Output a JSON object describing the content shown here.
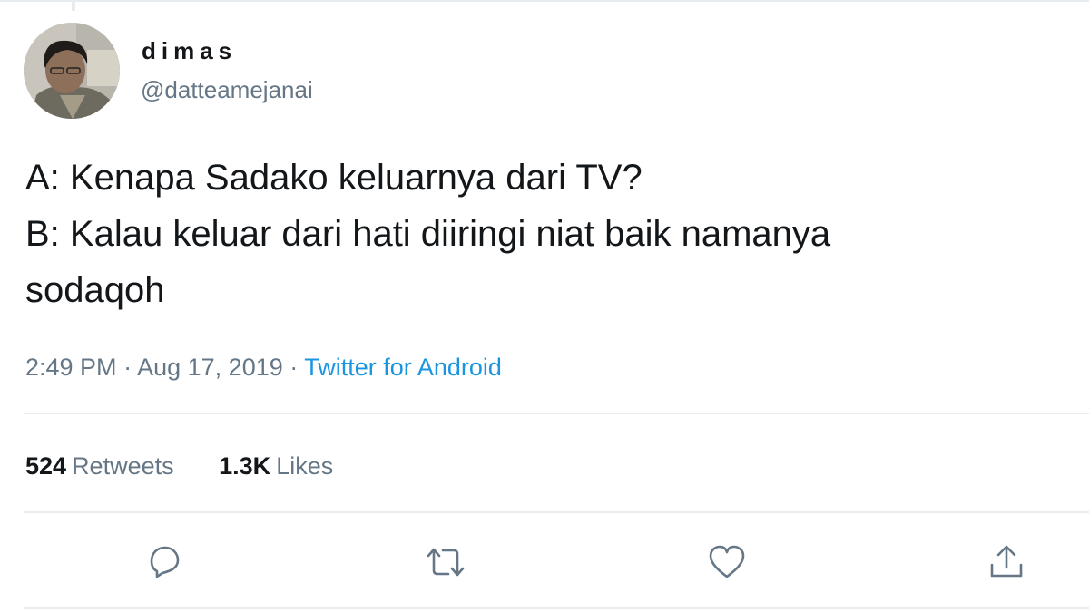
{
  "user": {
    "display_name": "dimas",
    "handle": "@datteamejanai"
  },
  "tweet": {
    "lines": [
      "A: Kenapa Sadako keluarnya dari TV?",
      "B: Kalau keluar dari hati diiringi niat baik namanya",
      "sodaqoh"
    ],
    "time": "2:49 PM",
    "date": "Aug 17, 2019",
    "separator": "·",
    "source": "Twitter for Android"
  },
  "stats": {
    "retweets_count": "524",
    "retweets_label": "Retweets",
    "likes_count": "1.3K",
    "likes_label": "Likes"
  },
  "actions": [
    {
      "name": "reply",
      "icon": "reply-icon"
    },
    {
      "name": "retweet",
      "icon": "retweet-icon"
    },
    {
      "name": "like",
      "icon": "heart-icon"
    },
    {
      "name": "share",
      "icon": "share-icon"
    }
  ],
  "colors": {
    "text_primary": "#14171a",
    "text_secondary": "#657786",
    "link": "#1b95e0",
    "divider": "#e6ecf0"
  }
}
